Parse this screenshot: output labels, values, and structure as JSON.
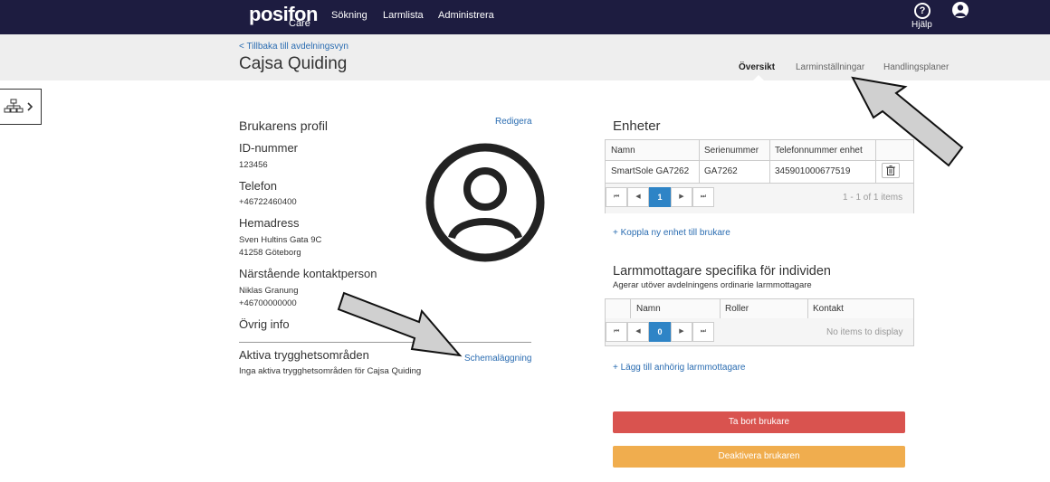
{
  "app": {
    "logo_main": "posifon",
    "logo_sub": "Care"
  },
  "nav": {
    "items": [
      {
        "label": "Sökning"
      },
      {
        "label": "Larmlista"
      },
      {
        "label": "Administrera"
      }
    ],
    "help_label": "Hjälp"
  },
  "header": {
    "back_link": "< Tillbaka till avdelningsvyn",
    "title": "Cajsa Quiding",
    "tabs": [
      {
        "label": "Översikt",
        "active": true
      },
      {
        "label": "Larminställningar"
      },
      {
        "label": "Handlingsplaner"
      }
    ]
  },
  "profile": {
    "heading": "Brukarens profil",
    "edit_link": "Redigera",
    "id_label": "ID-nummer",
    "id_value": "123456",
    "phone_label": "Telefon",
    "phone_value": "+46722460400",
    "address_label": "Hemadress",
    "address_line1": "Sven Hultins Gata 9C",
    "address_line2": "41258 Göteborg",
    "contact_label": "Närstående kontaktperson",
    "contact_name": "Niklas Granung",
    "contact_phone": "+46700000000",
    "other_label": "Övrig info",
    "zones_label": "Aktiva trygghetsområden",
    "zones_link": "Schemaläggning",
    "zones_empty": "Inga aktiva trygghetsområden för Cajsa Quiding"
  },
  "devices": {
    "heading": "Enheter",
    "columns": [
      "Namn",
      "Serienummer",
      "Telefonnummer enhet",
      ""
    ],
    "rows": [
      [
        "SmartSole GA7262",
        "GA7262",
        "345901000677519"
      ]
    ],
    "pager": {
      "first": "⏮",
      "prev": "◀",
      "page": "1",
      "next": "▶",
      "last": "⏭",
      "info": "1 - 1 of 1 items"
    },
    "add_link": "+ Koppla ny enhet till brukare"
  },
  "receivers": {
    "heading": "Larmmottagare specifika för individen",
    "subheading": "Agerar utöver avdelningens ordinarie larmmottagare",
    "columns": [
      "",
      "Namn",
      "Roller",
      "Kontakt"
    ],
    "pager": {
      "first": "⏮",
      "prev": "◀",
      "page": "0",
      "next": "▶",
      "last": "⏭",
      "info": "No items to display"
    },
    "add_link": "+ Lägg till anhörig larmmottagare"
  },
  "actions": {
    "remove_label": "Ta bort brukare",
    "deactivate_label": "Deaktivera brukaren"
  },
  "colors": {
    "nav_bg": "#1d1c40",
    "link": "#2a6cb1",
    "pager_active": "#2e84c6",
    "danger": "#d9534f",
    "warning": "#f0ad4e"
  }
}
